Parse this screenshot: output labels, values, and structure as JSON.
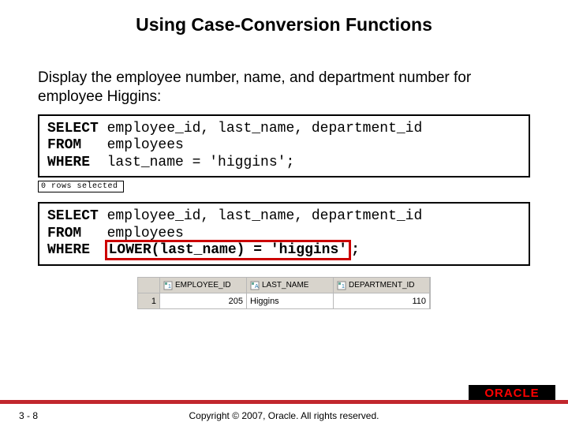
{
  "title": "Using Case-Conversion Functions",
  "description": "Display the employee number, name, and department number for employee Higgins:",
  "code1": {
    "kw1": "SELECT",
    "c1": " employee_id, last_name, department_id",
    "kw2": "FROM",
    "c2": "   employees",
    "kw3": "WHERE",
    "c3": "  last_name = 'higgins';"
  },
  "status1": "0 rows selected",
  "code2": {
    "kw1": "SELECT",
    "c1": " employee_id, last_name, department_id",
    "kw2": "FROM",
    "c2": "   employees",
    "kw3": "WHERE",
    "c3a": "  ",
    "hl": "LOWER(last_name) = 'higgins'",
    "c3b": ";"
  },
  "result": {
    "rownum": "1",
    "headers": {
      "c1": "EMPLOYEE_ID",
      "c2": "LAST_NAME",
      "c3": "DEPARTMENT_ID"
    },
    "row": {
      "c1": "205",
      "c2": "Higgins",
      "c3": "110"
    }
  },
  "page": "3 - 8",
  "copyright": "Copyright © 2007, Oracle. All rights reserved.",
  "logo_text": "ORACLE"
}
